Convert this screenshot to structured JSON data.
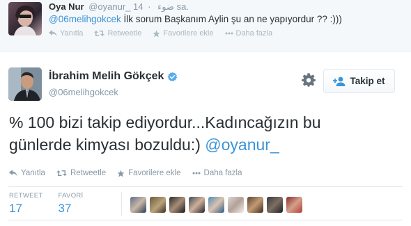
{
  "reply": {
    "name": "Oya Nur",
    "screen_name": "@oyanur_",
    "arabic_name": "ضوء",
    "dot": "·",
    "time": "14 sa.",
    "mention": "@06melihgokcek",
    "text_rest": " İlk sorum Başkanım Aylin şu an ne yapıyordur ?? :)))",
    "actions": {
      "reply": "Yanıtla",
      "retweet": "Retweetle",
      "favorite": "Favorilere ekle",
      "more": "Daha fazla"
    }
  },
  "tweet": {
    "name": "İbrahim Melih Gökçek",
    "screen_name": "@06melihgokcek",
    "follow_label": "Takip et",
    "text_line1": "% 100 bizi takip ediyordur...Kadıncağızın bu",
    "text_line2_plain": "günlerde kimyası bozuldu:) ",
    "text_line2_mention": "@oyanur_",
    "actions": {
      "reply": "Yanıtla",
      "retweet": "Retweetle",
      "favorite": "Favorilere ekle",
      "more": "Daha fazla"
    },
    "stats": {
      "retweet_label": "RETWEET",
      "retweet_count": "17",
      "favori_label": "FAVORİ",
      "favori_count": "37"
    }
  },
  "colors": {
    "link": "#3b94d9",
    "verified": "#55acee",
    "muted": "#8899a6"
  },
  "favoriter_avatars": [
    "avatar-1",
    "avatar-2",
    "avatar-3",
    "avatar-4",
    "avatar-5",
    "avatar-6",
    "avatar-7",
    "avatar-8",
    "avatar-9"
  ]
}
